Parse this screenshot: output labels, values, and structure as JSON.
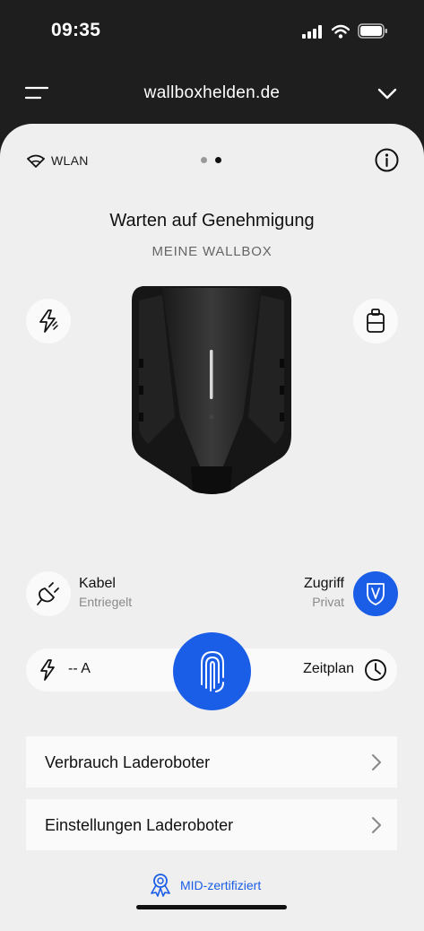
{
  "status_bar": {
    "time": "09:35"
  },
  "header": {
    "site": "wallboxhelden.de"
  },
  "connection": {
    "label": "WLAN"
  },
  "wallbox": {
    "status": "Warten auf Genehmigung",
    "name": "MEINE WALLBOX"
  },
  "cable": {
    "title": "Kabel",
    "state": "Entriegelt"
  },
  "access": {
    "title": "Zugriff",
    "state": "Privat"
  },
  "charge": {
    "current": "-- A",
    "schedule_label": "Zeitplan"
  },
  "menu": [
    {
      "label": "Verbrauch Laderoboter"
    },
    {
      "label": "Einstellungen Laderoboter"
    }
  ],
  "footer": {
    "certification": "MID-zertifiziert"
  },
  "pager": {
    "count": 2,
    "active": 2
  },
  "colors": {
    "accent": "#1a5de6",
    "background": "#1e1e1e",
    "card": "#efefef"
  }
}
